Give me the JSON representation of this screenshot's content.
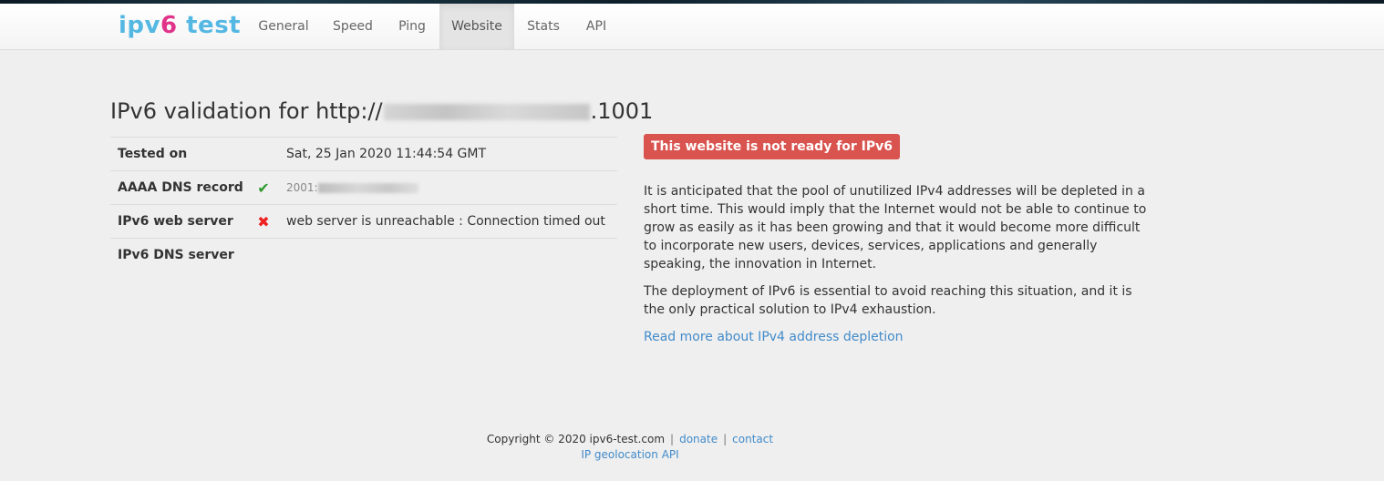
{
  "brand": {
    "part1": "ipv",
    "part2": "6",
    "part3": " test"
  },
  "nav": {
    "items": [
      {
        "label": "General"
      },
      {
        "label": "Speed"
      },
      {
        "label": "Ping"
      },
      {
        "label": "Website",
        "active": true
      },
      {
        "label": "Stats"
      },
      {
        "label": "API"
      }
    ]
  },
  "title": {
    "prefix": "IPv6 validation for http://",
    "suffix": ".1001"
  },
  "results": [
    {
      "label": "Tested on",
      "status": "",
      "value": "Sat, 25 Jan 2020 11:44:54 GMT"
    },
    {
      "label": "AAAA DNS record",
      "status": "ok",
      "status_icon": "✔",
      "value": "2001:"
    },
    {
      "label": "IPv6 web server",
      "status": "fail",
      "status_icon": "✖",
      "value": "web server is unreachable : Connection timed out"
    },
    {
      "label": "IPv6 DNS server",
      "status": "",
      "value": ""
    }
  ],
  "verdict": "This website is not ready for IPv6",
  "paragraphs": [
    "It is anticipated that the pool of unutilized IPv4 addresses will be depleted in a short time. This would imply that the Internet would not be able to continue to grow as easily as it has been growing and that it would become more difficult to incorporate new users, devices, services, applications and generally speaking, the innovation in Internet.",
    "The deployment of IPv6 is essential to avoid reaching this situation, and it is the only practical solution to IPv4 exhaustion."
  ],
  "read_more": "Read more about IPv4 address depletion",
  "footer": {
    "copyright": "Copyright © 2020 ipv6-test.com",
    "donate": "donate",
    "contact": "contact",
    "separator": "|",
    "geo_api": "IP geolocation API"
  },
  "colors": {
    "verdict_bg": "#d9534f",
    "link": "#428bca",
    "ok": "#2e9a2e",
    "fail": "#e22222"
  }
}
